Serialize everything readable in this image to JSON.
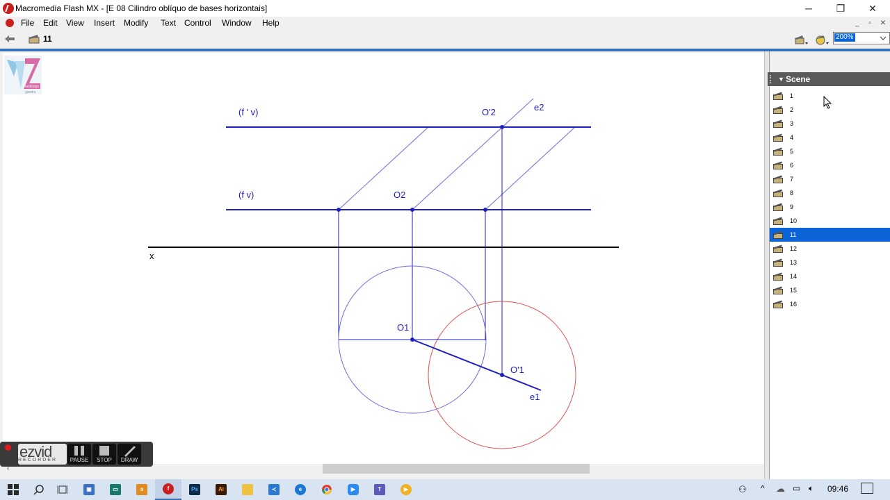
{
  "window": {
    "title": "Macromedia Flash MX - [E 08 Cilindro oblíquo de bases horizontais]",
    "controls": {
      "minimize": "─",
      "restore": "❐",
      "close": "✕"
    }
  },
  "menu": [
    "File",
    "Edit",
    "View",
    "Insert",
    "Modify",
    "Text",
    "Control",
    "Window",
    "Help"
  ],
  "editbar": {
    "current_scene": "11",
    "zoom": "200%"
  },
  "drawing": {
    "labels": {
      "fpv": "(f ' v)",
      "fv": "(f v)",
      "o2p": "O'2",
      "e2": "e2",
      "o2": "O2",
      "x": "x",
      "o1": "O1",
      "o1p": "O'1",
      "e1": "e1"
    },
    "colors": {
      "blue": "#2020c0",
      "light_blue": "#6a6adc",
      "red": "#e05050",
      "black": "#000000"
    }
  },
  "scene_panel": {
    "title": "Scene",
    "scenes": [
      "1",
      "2",
      "3",
      "4",
      "5",
      "6",
      "7",
      "8",
      "9",
      "10",
      "11",
      "12",
      "13",
      "14",
      "15",
      "16"
    ],
    "selected_index": 10
  },
  "logo": {
    "text_top": "ezdesign",
    "text_bottom": "gandra"
  },
  "ezvid": {
    "brand": "ezvid",
    "sub": "RECORDER",
    "buttons": [
      "PAUSE",
      "STOP",
      "DRAW"
    ]
  },
  "taskbar": {
    "clock": "09:46",
    "tray_chevron": "^"
  }
}
